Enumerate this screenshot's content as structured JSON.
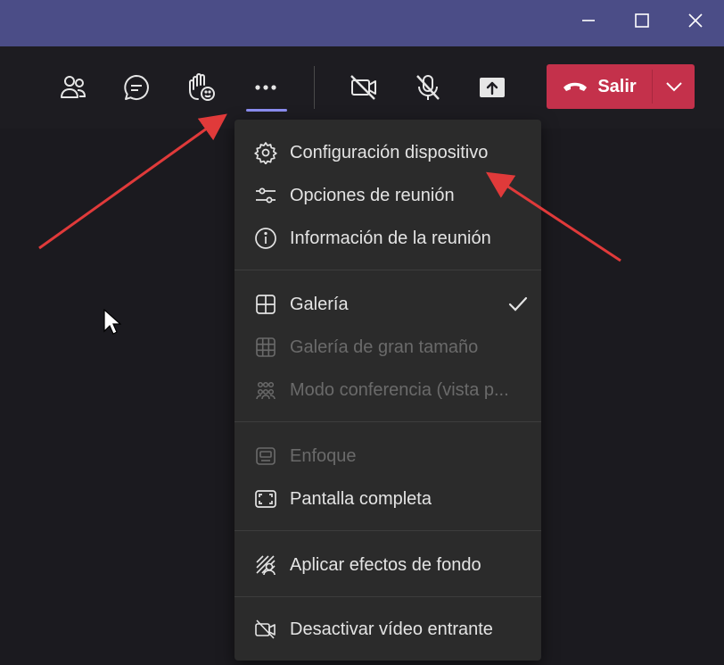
{
  "titlebar": {
    "controls": [
      "minimize-icon",
      "maximize-icon",
      "close-icon"
    ],
    "color": "#4b4d87"
  },
  "toolbar": {
    "buttons": [
      "people-icon",
      "chat-icon",
      "raise-hand-icon",
      "more-options-icon",
      "camera-off-icon",
      "mic-off-icon",
      "share-screen-icon"
    ],
    "leave": {
      "label": "Salir",
      "color": "#c4314b"
    }
  },
  "menu": {
    "sections": [
      {
        "items": [
          {
            "label": "Configuración dispositivo",
            "icon": "gear-icon",
            "enabled": true
          },
          {
            "label": "Opciones de reunión",
            "icon": "sliders-icon",
            "enabled": true
          },
          {
            "label": "Información de la reunión",
            "icon": "info-icon",
            "enabled": true
          }
        ]
      },
      {
        "items": [
          {
            "label": "Galería",
            "icon": "gallery-icon",
            "enabled": true,
            "checked": true
          },
          {
            "label": "Galería de gran tamaño",
            "icon": "large-gallery-icon",
            "enabled": false
          },
          {
            "label": "Modo conferencia (vista p...",
            "icon": "conference-mode-icon",
            "enabled": false
          }
        ]
      },
      {
        "items": [
          {
            "label": "Enfoque",
            "icon": "focus-icon",
            "enabled": false
          },
          {
            "label": "Pantalla completa",
            "icon": "fullscreen-icon",
            "enabled": true
          }
        ]
      },
      {
        "items": [
          {
            "label": "Aplicar efectos de fondo",
            "icon": "background-effects-icon",
            "enabled": true
          }
        ]
      },
      {
        "items": [
          {
            "label": "Desactivar vídeo entrante",
            "icon": "video-off-icon",
            "enabled": true
          }
        ]
      }
    ]
  },
  "annotations": {
    "arrow_color": "#e03a3a"
  }
}
